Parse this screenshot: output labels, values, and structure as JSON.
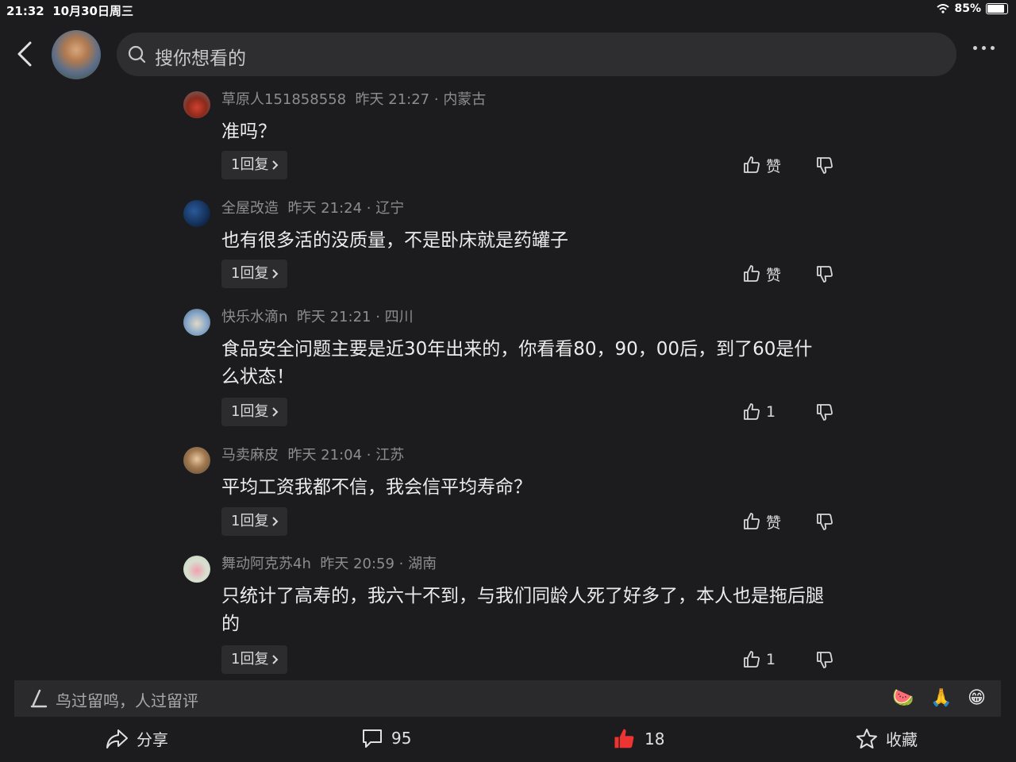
{
  "status_bar": {
    "time": "21:32",
    "date": "10月30日周三",
    "battery": "85%"
  },
  "header": {
    "search_placeholder": "搜你想看的"
  },
  "icons": {
    "back": "back-chevron-icon",
    "search": "search-icon",
    "more": "more-dots-icon",
    "like": "thumb-up-icon",
    "dislike": "thumb-down-icon",
    "share": "share-icon",
    "comment": "comment-icon",
    "favorite": "star-icon",
    "edit": "pen-icon"
  },
  "colors": {
    "background": "#1c1c1e",
    "like_active": "#ee3333",
    "meta_text": "#8d8d8f"
  },
  "comments": [
    {
      "user": "草原人151858558",
      "time": "昨天 21:27",
      "location": "内蒙古",
      "text": "准吗？",
      "replies": "1回复",
      "likes": "赞"
    },
    {
      "user": "全屋改造",
      "time": "昨天 21:24",
      "location": "辽宁",
      "text": "也有很多活的没质量，不是卧床就是药罐子",
      "replies": "1回复",
      "likes": "赞"
    },
    {
      "user": "快乐水滴n",
      "time": "昨天 21:21",
      "location": "四川",
      "text": "食品安全问题主要是近30年出来的，你看看80，90，00后，到了60是什么状态！",
      "replies": "1回复",
      "likes": "1"
    },
    {
      "user": "马卖麻皮",
      "time": "昨天 21:04",
      "location": "江苏",
      "text": "平均工资我都不信，我会信平均寿命？",
      "replies": "1回复",
      "likes": "赞"
    },
    {
      "user": "舞动阿克苏4h",
      "time": "昨天 20:59",
      "location": "湖南",
      "text": "只统计了高寿的，我六十不到，与我们同龄人死了好多了，本人也是拖后腿的",
      "replies": "1回复",
      "likes": "1"
    }
  ],
  "input": {
    "placeholder": "鸟过留鸣，人过留评",
    "emojis": [
      "🍉",
      "🙏",
      "😁"
    ]
  },
  "bottom_bar": {
    "share_label": "分享",
    "comment_count": "95",
    "like_count": "18",
    "favorite_label": "收藏"
  }
}
